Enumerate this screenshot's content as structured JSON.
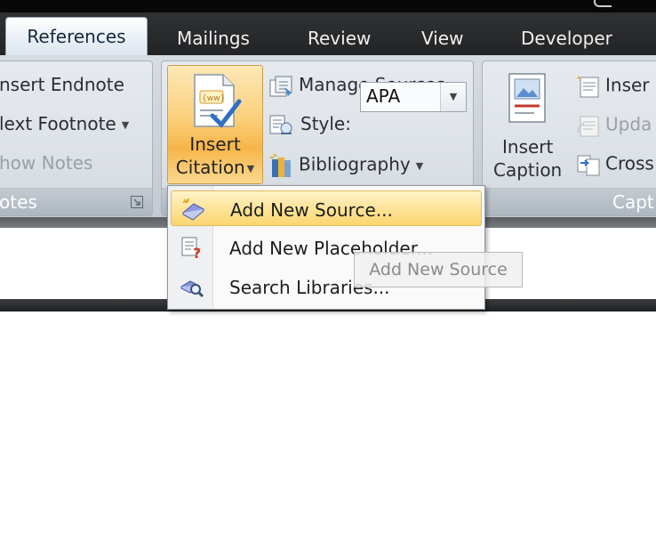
{
  "tabs": [
    {
      "label": "References",
      "active": true
    },
    {
      "label": "Mailings"
    },
    {
      "label": "Review"
    },
    {
      "label": "View"
    },
    {
      "label": "Developer"
    }
  ],
  "footnotes_group": {
    "insert_endnote": "nsert Endnote",
    "next_footnote": "lext Footnote",
    "show_notes": "how Notes",
    "footer": "otes"
  },
  "citations_group": {
    "insert_citation_line1": "Insert",
    "insert_citation_line2": "Citation",
    "manage_sources": "Manage Sources",
    "style_label": "Style:",
    "style_value": "APA",
    "bibliography": "Bibliography"
  },
  "captions_group": {
    "insert_caption_line1": "Insert",
    "insert_caption_line2": "Caption",
    "insert_table_of_figures": "Inser",
    "update_table": "Upda",
    "cross_reference": "Cross",
    "footer": "Capt"
  },
  "citation_menu": {
    "items": [
      {
        "label": "Add New Source...",
        "highlighted": true,
        "icon": "book-plus-icon"
      },
      {
        "label": "Add New Placeholder...",
        "highlighted": false,
        "icon": "placeholder-question-icon"
      },
      {
        "label": "Search Libraries...",
        "highlighted": false,
        "icon": "search-library-icon"
      }
    ]
  },
  "tooltip": "Add New Source",
  "colors": {
    "highlight": "#fbd670",
    "tab_bar": "#2a2c2e",
    "ribbon": "#dde2e7"
  }
}
